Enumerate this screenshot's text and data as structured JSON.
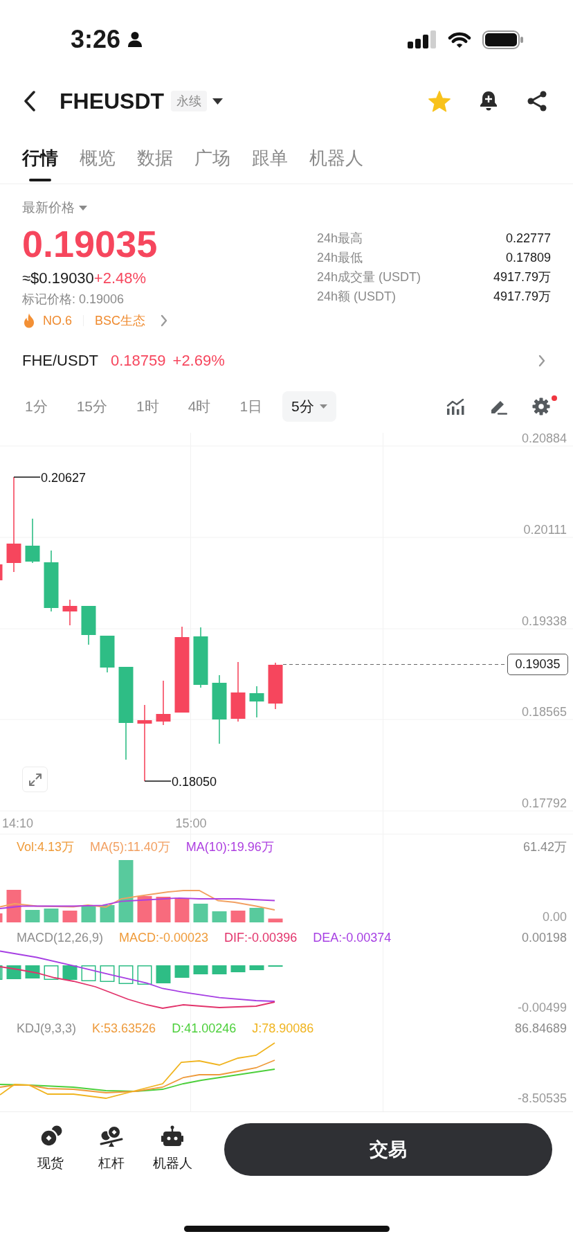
{
  "status_bar": {
    "time": "3:26"
  },
  "header": {
    "symbol": "FHEUSDT",
    "contract_type": "永续",
    "favorite": true
  },
  "tabs": [
    {
      "label": "行情",
      "selected": true
    },
    {
      "label": "概览",
      "selected": false
    },
    {
      "label": "数据",
      "selected": false
    },
    {
      "label": "广场",
      "selected": false
    },
    {
      "label": "跟单",
      "selected": false
    },
    {
      "label": "机器人",
      "selected": false
    }
  ],
  "price": {
    "label": "最新价格",
    "last": "0.19035",
    "usd": "≈$0.19030",
    "change": "+2.48%",
    "mark_price": "标记价格: 0.19006",
    "rank": "NO.6",
    "sector": "BSC生态"
  },
  "stats": [
    {
      "label": "24h最高",
      "value": "0.22777"
    },
    {
      "label": "24h最低",
      "value": "0.17809"
    },
    {
      "label": "24h成交量 (USDT)",
      "value": "4917.79万"
    },
    {
      "label": "24h额 (USDT)",
      "value": "4917.79万"
    }
  ],
  "spot_pair": {
    "pair": "FHE/USDT",
    "price": "0.18759",
    "change": "+2.69%"
  },
  "intervals": [
    {
      "label": "1分",
      "selected": false,
      "kind": "option"
    },
    {
      "label": "15分",
      "selected": false,
      "kind": "option"
    },
    {
      "label": "1时",
      "selected": false,
      "kind": "option"
    },
    {
      "label": "4时",
      "selected": false,
      "kind": "option"
    },
    {
      "label": "1日",
      "selected": false,
      "kind": "option"
    },
    {
      "label": "5分",
      "selected": true,
      "kind": "dropdown"
    }
  ],
  "chart_tools": {
    "settings_badge": true
  },
  "chart": {
    "price_ticks": [
      "0.20884",
      "0.20111",
      "0.19338",
      "0.18565",
      "0.17792"
    ],
    "high_marker": "0.20627",
    "low_marker": "0.18050",
    "last_price": "0.19035",
    "time_ticks": [
      "14:10",
      "15:00"
    ]
  },
  "volume": {
    "legend": [
      {
        "text": "Vol:4.13万",
        "color": "#ef9b3a"
      },
      {
        "text": "MA(5):11.40万",
        "color": "#f2a062"
      },
      {
        "text": "MA(10):19.96万",
        "color": "#ad3fe0"
      }
    ],
    "scale_max": "61.42万",
    "scale_min": "0.00"
  },
  "macd": {
    "legend": [
      {
        "text": "MACD(12,26,9)",
        "color": "#8e8e8e"
      },
      {
        "text": "MACD:-0.00023",
        "color": "#ef9b3a"
      },
      {
        "text": "DIF:-0.00396",
        "color": "#e2336b"
      },
      {
        "text": "DEA:-0.00374",
        "color": "#a63fe3"
      }
    ],
    "scale_max": "0.00198",
    "scale_min": "-0.00499"
  },
  "kdj": {
    "legend": [
      {
        "text": "KDJ(9,3,3)",
        "color": "#8e8e8e"
      },
      {
        "text": "K:53.63526",
        "color": "#ee9a3b"
      },
      {
        "text": "D:41.00246",
        "color": "#4ccf3b"
      },
      {
        "text": "J:78.90086",
        "color": "#f0b41f"
      }
    ],
    "scale_max": "86.84689",
    "scale_min": "-8.50535"
  },
  "bottom_nav": [
    {
      "label": "现货"
    },
    {
      "label": "杠杆"
    },
    {
      "label": "机器人"
    }
  ],
  "trade_button": "交易"
}
